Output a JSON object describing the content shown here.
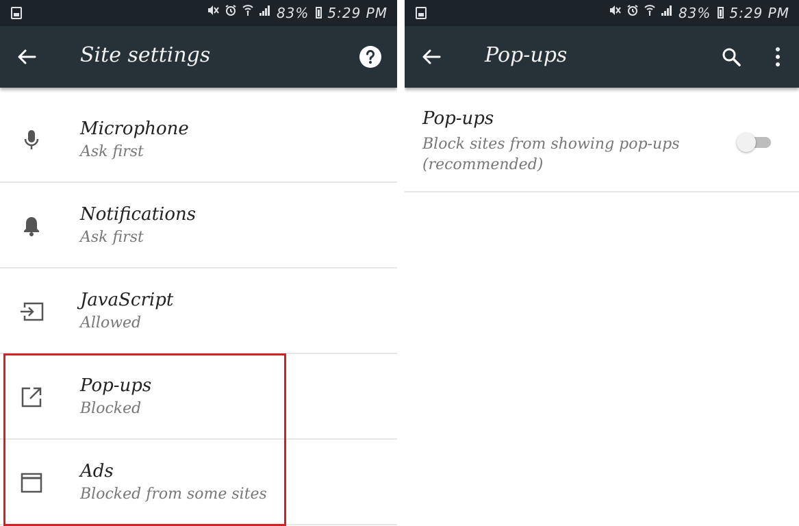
{
  "status_bar": {
    "battery": "83%",
    "time": "5:29 PM"
  },
  "left_screen": {
    "title": "Site settings",
    "items": [
      {
        "title": "Microphone",
        "subtitle": "Ask first",
        "icon": "microphone-icon"
      },
      {
        "title": "Notifications",
        "subtitle": "Ask first",
        "icon": "bell-icon"
      },
      {
        "title": "JavaScript",
        "subtitle": "Allowed",
        "icon": "javascript-icon"
      },
      {
        "title": "Pop-ups",
        "subtitle": "Blocked",
        "icon": "open-in-new-icon"
      },
      {
        "title": "Ads",
        "subtitle": "Blocked from some sites",
        "icon": "window-icon"
      }
    ],
    "highlight_color": "#d51f26"
  },
  "right_screen": {
    "title": "Pop-ups",
    "preference": {
      "title": "Pop-ups",
      "subtitle": "Block sites from showing pop-ups (recommended)",
      "toggle_on": false
    }
  },
  "colors": {
    "toolbar": "#263238",
    "status_bar": "#1c2329",
    "divider": "#e6e6e6"
  }
}
